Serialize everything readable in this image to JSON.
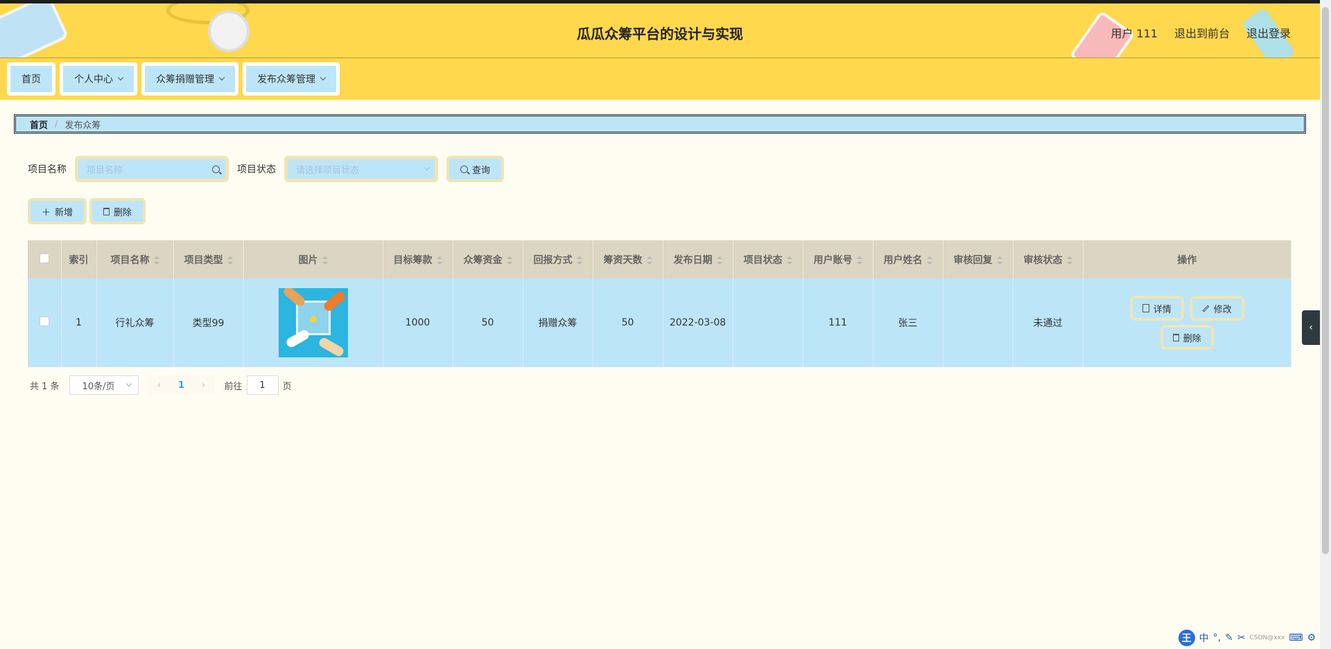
{
  "header": {
    "title": "瓜瓜众筹平台的设计与实现",
    "user": "用户 111",
    "back_front": "退出到前台",
    "logout": "退出登录"
  },
  "nav": {
    "items": [
      {
        "label": "首页"
      },
      {
        "label": "个人中心"
      },
      {
        "label": "众筹捐赠管理"
      },
      {
        "label": "发布众筹管理"
      }
    ]
  },
  "breadcrumb": {
    "home": "首页",
    "current": "发布众筹"
  },
  "search": {
    "name_label": "项目名称",
    "name_placeholder": "项目名称",
    "status_label": "项目状态",
    "status_placeholder": "请选择项目状态",
    "query_label": "查询"
  },
  "actions": {
    "add_label": "新增",
    "delete_label": "删除"
  },
  "table": {
    "headers": [
      "索引",
      "项目名称",
      "项目类型",
      "图片",
      "目标筹款",
      "众筹资金",
      "回报方式",
      "筹资天数",
      "发布日期",
      "项目状态",
      "用户账号",
      "用户姓名",
      "审核回复",
      "审核状态",
      "操作"
    ],
    "rows": [
      {
        "index": "1",
        "name": "行礼众筹",
        "type": "类型99",
        "target": "1000",
        "funds": "50",
        "reward": "捐赠众筹",
        "days": "50",
        "date": "2022-03-08",
        "status": "",
        "account": "111",
        "username": "张三",
        "reply": "",
        "audit": "未通过"
      }
    ],
    "ops": {
      "detail": "详情",
      "edit": "修改",
      "delete": "删除"
    }
  },
  "pager": {
    "total": "共 1 条",
    "page_size": "10条/页",
    "current": "1",
    "goto_prefix": "前往",
    "goto_value": "1",
    "goto_suffix": "页"
  },
  "tray": {
    "ime": "中",
    "badge": "王",
    "watermark": "CSDN@xxx"
  }
}
